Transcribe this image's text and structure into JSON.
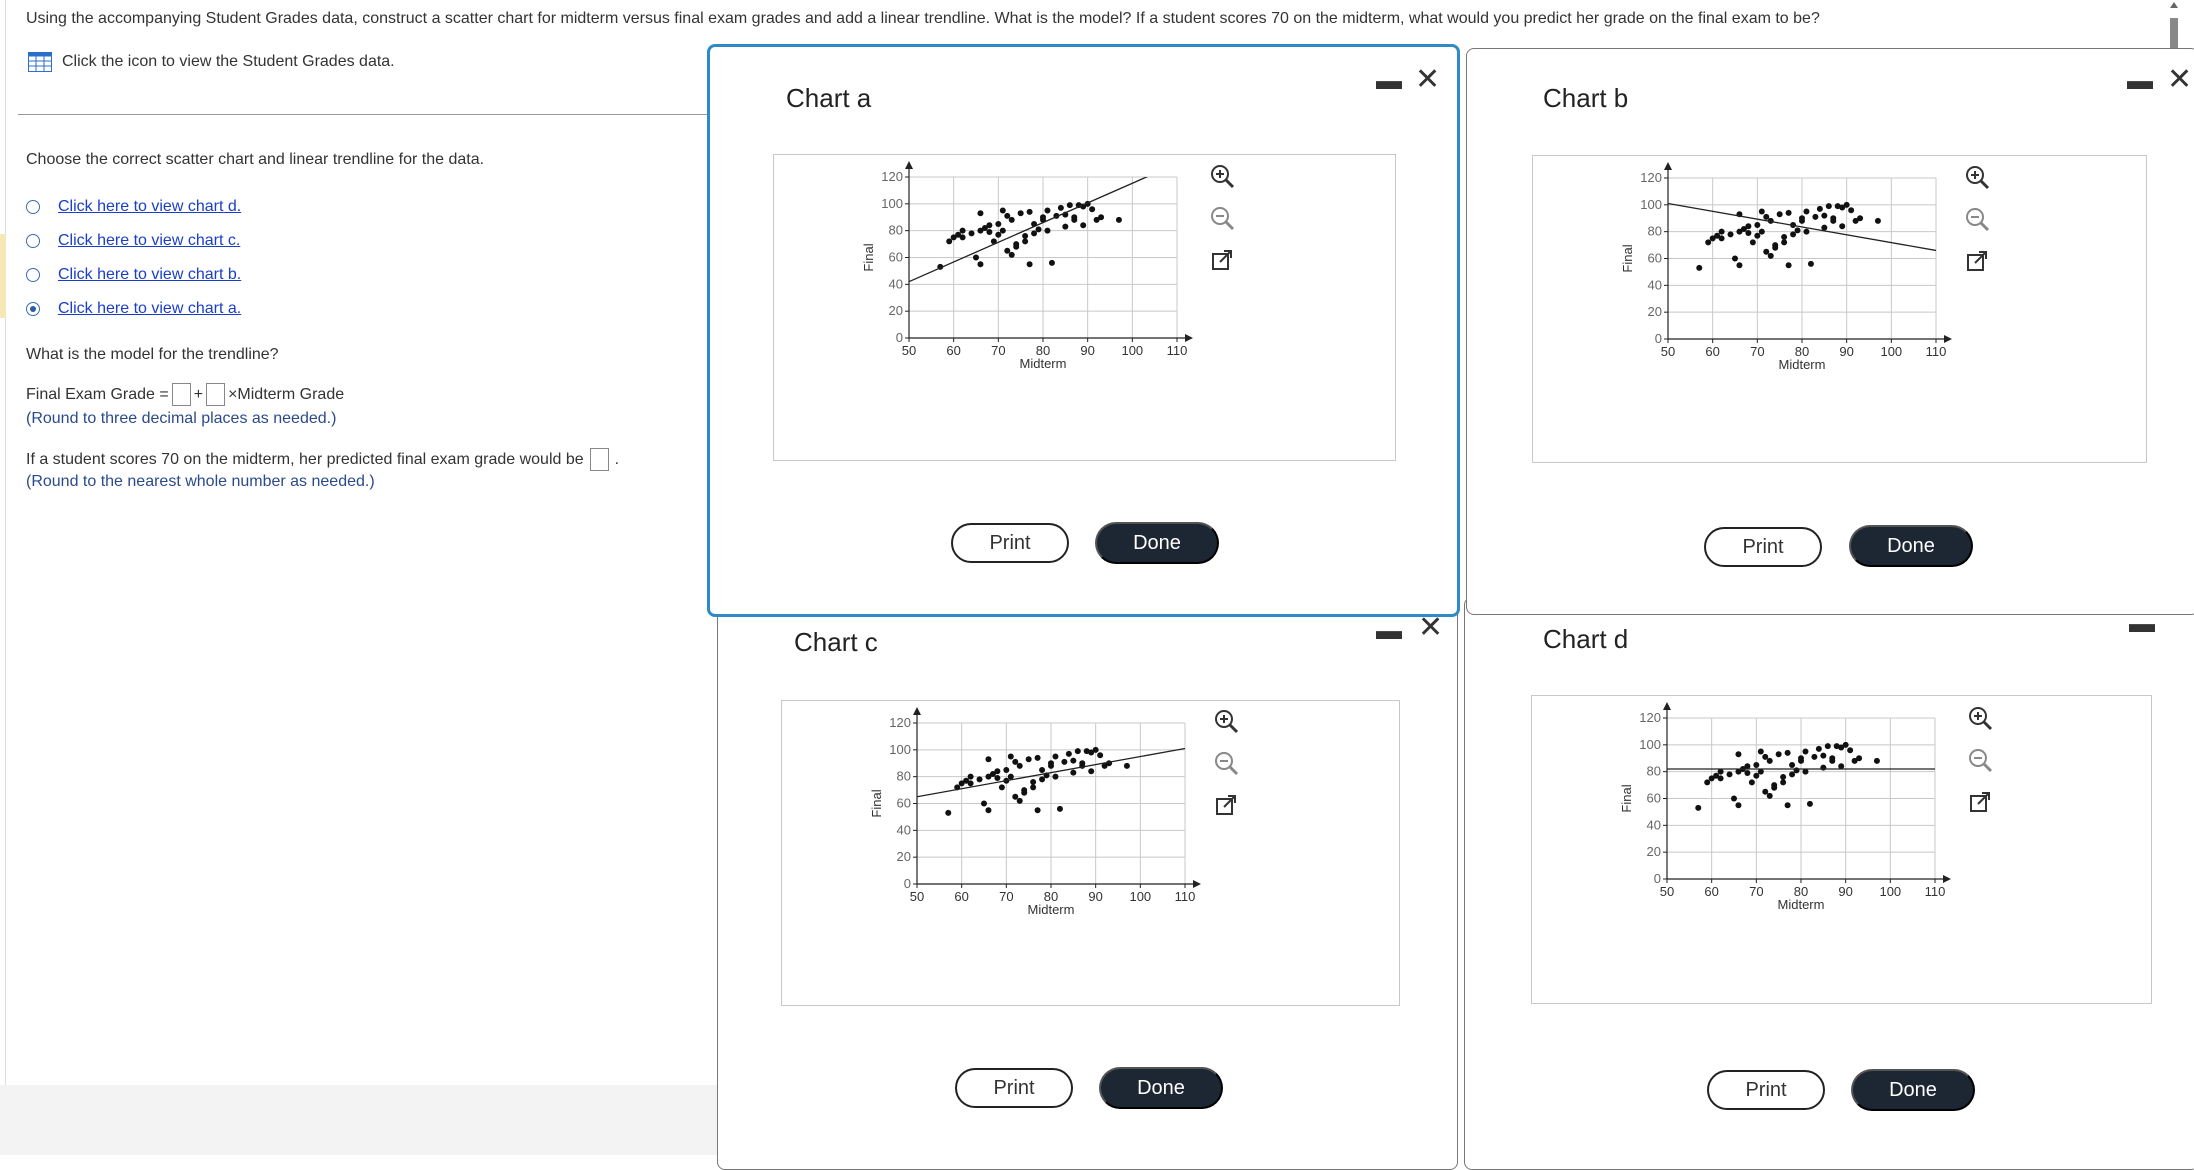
{
  "question": "Using the accompanying Student Grades data, construct a scatter chart for midterm versus final exam grades and add a linear trendline. What is the model? If a student scores 70 on the midterm, what would you predict her grade on the final exam to be?",
  "data_link": "Click the icon to view the Student Grades data.",
  "choose_prompt": "Choose the correct scatter chart and linear trendline for the data.",
  "options": [
    {
      "label": "Click here to view chart d.",
      "selected": false
    },
    {
      "label": "Click here to view chart c.",
      "selected": false
    },
    {
      "label": "Click here to view chart b.",
      "selected": false
    },
    {
      "label": "Click here to view chart a.",
      "selected": true
    }
  ],
  "model_prompt": "What is the model for the trendline?",
  "formula": {
    "lhs": "Final Exam Grade =",
    "plus": "+",
    "times": "×Midterm Grade",
    "intercept": "",
    "slope": ""
  },
  "round_hint_1": "(Round to three decimal places as needed.)",
  "prediction_prompt": "If a student scores 70 on the midterm, her predicted final exam grade would be",
  "prediction_value": "",
  "period": ".",
  "round_hint_2": "(Round to the nearest whole number as needed.)",
  "window_controls": {
    "minimize": "▬",
    "close": "✕"
  },
  "buttons": {
    "print": "Print",
    "done": "Done"
  },
  "icons": [
    "zoom-in-icon",
    "zoom-out-icon",
    "popout-icon"
  ],
  "colors": {
    "accent_border": "#2e8bc7",
    "done_bg": "#1c2733",
    "link": "#1a3ec9"
  },
  "chart_data": [
    {
      "title": "Chart a",
      "type": "scatter",
      "xlabel": "Midterm",
      "ylabel": "Final",
      "xlim": [
        50,
        110
      ],
      "ylim": [
        0,
        120
      ],
      "xticks": [
        "50",
        "60",
        "70",
        "80",
        "90",
        "100",
        "110"
      ],
      "yticks": [
        "0",
        "20",
        "40",
        "60",
        "80",
        "100",
        "120"
      ],
      "trendline": {
        "x": [
          50,
          110
        ],
        "y": [
          42,
          130
        ]
      },
      "points": [
        [
          57,
          53
        ],
        [
          59,
          72
        ],
        [
          60,
          75
        ],
        [
          61,
          77
        ],
        [
          62,
          75
        ],
        [
          62,
          80
        ],
        [
          64,
          78
        ],
        [
          65,
          60
        ],
        [
          66,
          80
        ],
        [
          66,
          93
        ],
        [
          66,
          55
        ],
        [
          67,
          82
        ],
        [
          68,
          79
        ],
        [
          68,
          84
        ],
        [
          69,
          72
        ],
        [
          70,
          85
        ],
        [
          70,
          77
        ],
        [
          71,
          95
        ],
        [
          71,
          80
        ],
        [
          72,
          65
        ],
        [
          72,
          91
        ],
        [
          73,
          62
        ],
        [
          73,
          88
        ],
        [
          74,
          68
        ],
        [
          74,
          70
        ],
        [
          75,
          93
        ],
        [
          76,
          72
        ],
        [
          76,
          76
        ],
        [
          77,
          94
        ],
        [
          77,
          55
        ],
        [
          78,
          85
        ],
        [
          78,
          78
        ],
        [
          79,
          81
        ],
        [
          80,
          90
        ],
        [
          80,
          88
        ],
        [
          81,
          80
        ],
        [
          81,
          95
        ],
        [
          82,
          56
        ],
        [
          83,
          91
        ],
        [
          84,
          97
        ],
        [
          85,
          83
        ],
        [
          85,
          92
        ],
        [
          86,
          99
        ],
        [
          87,
          88
        ],
        [
          87,
          90
        ],
        [
          88,
          99
        ],
        [
          89,
          84
        ],
        [
          89,
          98
        ],
        [
          90,
          100
        ],
        [
          91,
          96
        ],
        [
          92,
          88
        ],
        [
          93,
          90
        ],
        [
          97,
          88
        ]
      ]
    },
    {
      "title": "Chart b",
      "type": "scatter",
      "xlabel": "Midterm",
      "ylabel": "Final",
      "xlim": [
        50,
        110
      ],
      "ylim": [
        0,
        120
      ],
      "xticks": [
        "50",
        "60",
        "70",
        "80",
        "90",
        "100",
        "110"
      ],
      "yticks": [
        "0",
        "20",
        "40",
        "60",
        "80",
        "100",
        "120"
      ],
      "trendline": {
        "x": [
          50,
          110
        ],
        "y": [
          101,
          66
        ]
      },
      "points": [
        [
          57,
          53
        ],
        [
          59,
          72
        ],
        [
          60,
          75
        ],
        [
          61,
          77
        ],
        [
          62,
          75
        ],
        [
          62,
          80
        ],
        [
          64,
          78
        ],
        [
          65,
          60
        ],
        [
          66,
          80
        ],
        [
          66,
          93
        ],
        [
          66,
          55
        ],
        [
          67,
          82
        ],
        [
          68,
          79
        ],
        [
          68,
          84
        ],
        [
          69,
          72
        ],
        [
          70,
          85
        ],
        [
          70,
          77
        ],
        [
          71,
          95
        ],
        [
          71,
          80
        ],
        [
          72,
          65
        ],
        [
          72,
          91
        ],
        [
          73,
          62
        ],
        [
          73,
          88
        ],
        [
          74,
          68
        ],
        [
          74,
          70
        ],
        [
          75,
          93
        ],
        [
          76,
          72
        ],
        [
          76,
          76
        ],
        [
          77,
          94
        ],
        [
          77,
          55
        ],
        [
          78,
          85
        ],
        [
          78,
          78
        ],
        [
          79,
          81
        ],
        [
          80,
          90
        ],
        [
          80,
          88
        ],
        [
          81,
          80
        ],
        [
          81,
          95
        ],
        [
          82,
          56
        ],
        [
          83,
          91
        ],
        [
          84,
          97
        ],
        [
          85,
          83
        ],
        [
          85,
          92
        ],
        [
          86,
          99
        ],
        [
          87,
          88
        ],
        [
          87,
          90
        ],
        [
          88,
          99
        ],
        [
          89,
          84
        ],
        [
          89,
          98
        ],
        [
          90,
          100
        ],
        [
          91,
          96
        ],
        [
          92,
          88
        ],
        [
          93,
          90
        ],
        [
          97,
          88
        ]
      ]
    },
    {
      "title": "Chart c",
      "type": "scatter",
      "xlabel": "Midterm",
      "ylabel": "Final",
      "xlim": [
        50,
        110
      ],
      "ylim": [
        0,
        120
      ],
      "xticks": [
        "50",
        "60",
        "70",
        "80",
        "90",
        "100",
        "110"
      ],
      "yticks": [
        "0",
        "20",
        "40",
        "60",
        "80",
        "100",
        "120"
      ],
      "trendline": {
        "x": [
          50,
          110
        ],
        "y": [
          65,
          101
        ]
      },
      "points": [
        [
          57,
          53
        ],
        [
          59,
          72
        ],
        [
          60,
          75
        ],
        [
          61,
          77
        ],
        [
          62,
          75
        ],
        [
          62,
          80
        ],
        [
          64,
          78
        ],
        [
          65,
          60
        ],
        [
          66,
          80
        ],
        [
          66,
          93
        ],
        [
          66,
          55
        ],
        [
          67,
          82
        ],
        [
          68,
          79
        ],
        [
          68,
          84
        ],
        [
          69,
          72
        ],
        [
          70,
          85
        ],
        [
          70,
          77
        ],
        [
          71,
          95
        ],
        [
          71,
          80
        ],
        [
          72,
          65
        ],
        [
          72,
          91
        ],
        [
          73,
          62
        ],
        [
          73,
          88
        ],
        [
          74,
          68
        ],
        [
          74,
          70
        ],
        [
          75,
          93
        ],
        [
          76,
          72
        ],
        [
          76,
          76
        ],
        [
          77,
          94
        ],
        [
          77,
          55
        ],
        [
          78,
          85
        ],
        [
          78,
          78
        ],
        [
          79,
          81
        ],
        [
          80,
          90
        ],
        [
          80,
          88
        ],
        [
          81,
          80
        ],
        [
          81,
          95
        ],
        [
          82,
          56
        ],
        [
          83,
          91
        ],
        [
          84,
          97
        ],
        [
          85,
          83
        ],
        [
          85,
          92
        ],
        [
          86,
          99
        ],
        [
          87,
          88
        ],
        [
          87,
          90
        ],
        [
          88,
          99
        ],
        [
          89,
          84
        ],
        [
          89,
          98
        ],
        [
          90,
          100
        ],
        [
          91,
          96
        ],
        [
          92,
          88
        ],
        [
          93,
          90
        ],
        [
          97,
          88
        ]
      ]
    },
    {
      "title": "Chart d",
      "type": "scatter",
      "xlabel": "Midterm",
      "ylabel": "Final",
      "xlim": [
        50,
        110
      ],
      "ylim": [
        0,
        120
      ],
      "xticks": [
        "50",
        "60",
        "70",
        "80",
        "90",
        "100",
        "110"
      ],
      "yticks": [
        "0",
        "20",
        "40",
        "60",
        "80",
        "100",
        "120"
      ],
      "trendline": {
        "x": [
          50,
          110
        ],
        "y": [
          82,
          82
        ]
      },
      "points": [
        [
          57,
          53
        ],
        [
          59,
          72
        ],
        [
          60,
          75
        ],
        [
          61,
          77
        ],
        [
          62,
          75
        ],
        [
          62,
          80
        ],
        [
          64,
          78
        ],
        [
          65,
          60
        ],
        [
          66,
          80
        ],
        [
          66,
          93
        ],
        [
          66,
          55
        ],
        [
          67,
          82
        ],
        [
          68,
          79
        ],
        [
          68,
          84
        ],
        [
          69,
          72
        ],
        [
          70,
          85
        ],
        [
          70,
          77
        ],
        [
          71,
          95
        ],
        [
          71,
          80
        ],
        [
          72,
          65
        ],
        [
          72,
          91
        ],
        [
          73,
          62
        ],
        [
          73,
          88
        ],
        [
          74,
          68
        ],
        [
          74,
          70
        ],
        [
          75,
          93
        ],
        [
          76,
          72
        ],
        [
          76,
          76
        ],
        [
          77,
          94
        ],
        [
          77,
          55
        ],
        [
          78,
          85
        ],
        [
          78,
          78
        ],
        [
          79,
          81
        ],
        [
          80,
          90
        ],
        [
          80,
          88
        ],
        [
          81,
          80
        ],
        [
          81,
          95
        ],
        [
          82,
          56
        ],
        [
          83,
          91
        ],
        [
          84,
          97
        ],
        [
          85,
          83
        ],
        [
          85,
          92
        ],
        [
          86,
          99
        ],
        [
          87,
          88
        ],
        [
          87,
          90
        ],
        [
          88,
          99
        ],
        [
          89,
          84
        ],
        [
          89,
          98
        ],
        [
          90,
          100
        ],
        [
          91,
          96
        ],
        [
          92,
          88
        ],
        [
          93,
          90
        ],
        [
          97,
          88
        ]
      ]
    }
  ]
}
